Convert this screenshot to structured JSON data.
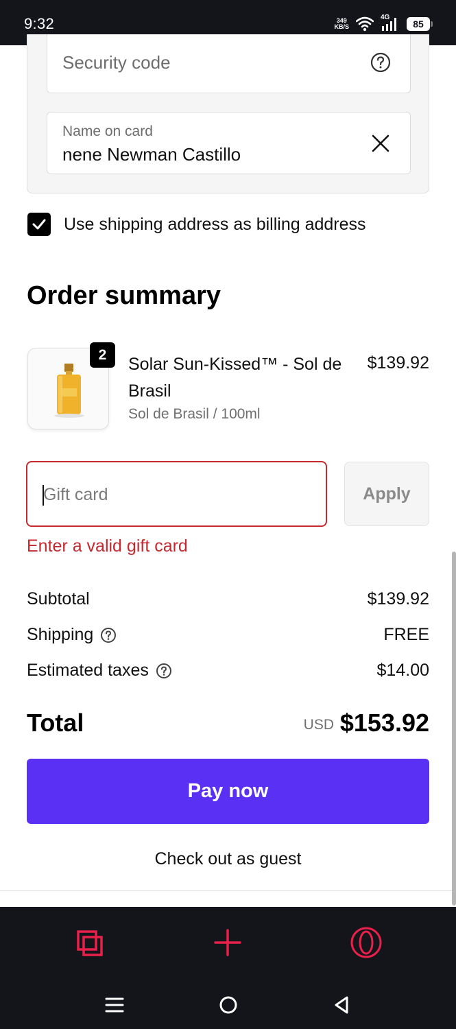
{
  "status_bar": {
    "time": "9:32",
    "net_speed_value": "349",
    "net_speed_unit": "KB/S",
    "network_type": "4G",
    "battery": "85"
  },
  "card_form": {
    "security_code_placeholder": "Security code",
    "name_on_card_label": "Name on card",
    "name_on_card_value": "nene Newman Castillo"
  },
  "billing": {
    "checkbox_checked": true,
    "label": "Use shipping address as billing address"
  },
  "order_summary": {
    "title": "Order summary",
    "item": {
      "quantity": "2",
      "name": "Solar Sun-Kissed™ - Sol de Brasil",
      "variant": "Sol de Brasil / 100ml",
      "price": "$139.92"
    }
  },
  "gift_card": {
    "placeholder": "Gift card",
    "apply_label": "Apply",
    "error": "Enter a valid gift card"
  },
  "totals": {
    "subtotal_label": "Subtotal",
    "subtotal_value": "$139.92",
    "shipping_label": "Shipping",
    "shipping_value": "FREE",
    "taxes_label": "Estimated taxes",
    "taxes_value": "$14.00",
    "total_label": "Total",
    "total_currency": "USD",
    "total_value": "$153.92"
  },
  "actions": {
    "pay_now": "Pay now",
    "guest": "Check out as guest"
  },
  "colors": {
    "pay_button": "#5a31f4",
    "error": "#c5282e",
    "browser_accent": "#e8204a",
    "system_bar": "#14151b"
  },
  "icons": {
    "security_help": "question-circle-icon",
    "name_clear": "close-icon",
    "shipping_help": "question-circle-icon",
    "taxes_help": "question-circle-icon",
    "browser_tabs": "tabs-icon",
    "browser_new_tab": "plus-icon",
    "browser_menu": "opera-logo-icon",
    "nav_recents": "menu-lines-icon",
    "nav_home": "circle-home-icon",
    "nav_back": "triangle-back-icon"
  }
}
